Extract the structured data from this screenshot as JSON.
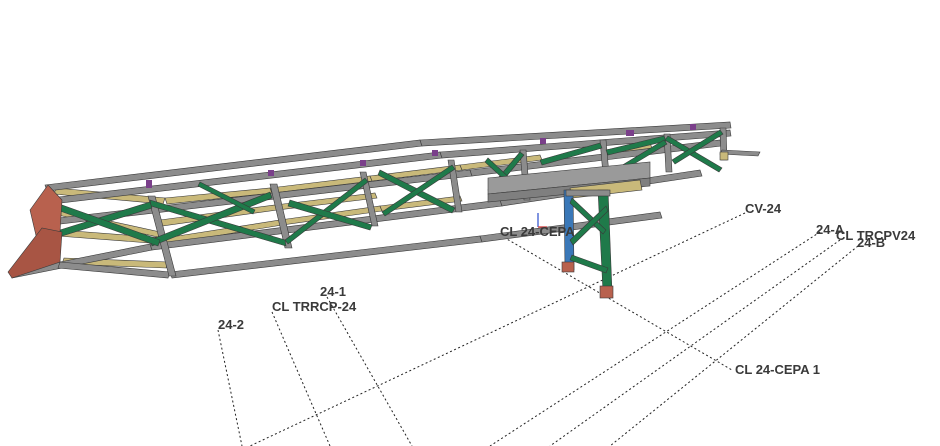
{
  "labels": {
    "cv_24": "CV-24",
    "gl_24_a": "24-A",
    "gl_24_b": "24-B",
    "cl_trcpv24": "CL TRCPV24",
    "cl_24_cepa": "CL 24-CEPA",
    "cl_24_cepa_1": "CL 24-CEPA 1",
    "gl_24_1": "24-1",
    "cl_trrcp_24": "CL TRRCP-24",
    "gl_24_2": "24-2"
  },
  "colors": {
    "background": "#ffffff",
    "chord_gray": "#8c8c8c",
    "bracing_green": "#1f7a4a",
    "bracing_tan": "#c9b97a",
    "end_plate_red": "#b8614e",
    "purple_plate": "#7a3f8a",
    "bent_blue": "#3a78b8",
    "gridline": "#222222",
    "label_text": "#3a3a3a"
  }
}
